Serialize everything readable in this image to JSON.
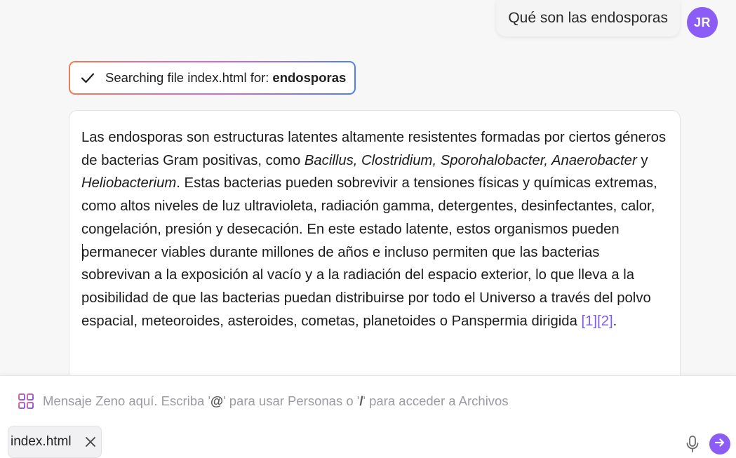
{
  "user_message": {
    "text": "Qué son las endosporas",
    "avatar_initials": "JR",
    "avatar_color": "#8b5cf6"
  },
  "search_status": {
    "prefix": "Searching file index.html for:",
    "query": "endosporas",
    "icon": "check-icon"
  },
  "answer": {
    "part1": "Las endosporas son estructuras latentes altamente resistentes formadas por ciertos géneros de bacterias Gram positivas, como ",
    "italic1": "Bacillus, Clostridium, Sporohalobacter, Anaerobacter",
    "part2": " y ",
    "italic2": "Heliobacterium",
    "part3": ". Estas bacterias pueden sobrevivir a tensiones físicas y químicas extremas, como altos niveles de luz ultravioleta, radiación gamma, detergentes, desinfectantes, calor, congelación, presión y desecación. En este estado latente, estos organismos pueden permanecer viables durante millones de años e incluso permiten que las bacterias sobrevivan a la exposición al vacío y a la radiación del espacio exterior, lo que lleva a la posibilidad de que las bacterias puedan distribuirse por todo el Universo a través del polvo espacial, meteoroides, asteroides, cometas, planetoides o Panspermia dirigida ",
    "citation1": "[1]",
    "citation2": "[2]",
    "part4": ".",
    "citation_color": "#7c5cf0"
  },
  "composer": {
    "placeholder_start": "Mensaje Zeno aquí. Escriba '",
    "placeholder_at": "@",
    "placeholder_mid": "' para usar Personas o '",
    "placeholder_slash": "/",
    "placeholder_end": "' para acceder a Archivos",
    "attached_file": "index.html",
    "grid_icon": "grid-icon",
    "mic_icon": "microphone-icon",
    "send_icon": "send-arrow-icon",
    "remove_icon": "close-icon",
    "accent": "#8b5cf6"
  }
}
